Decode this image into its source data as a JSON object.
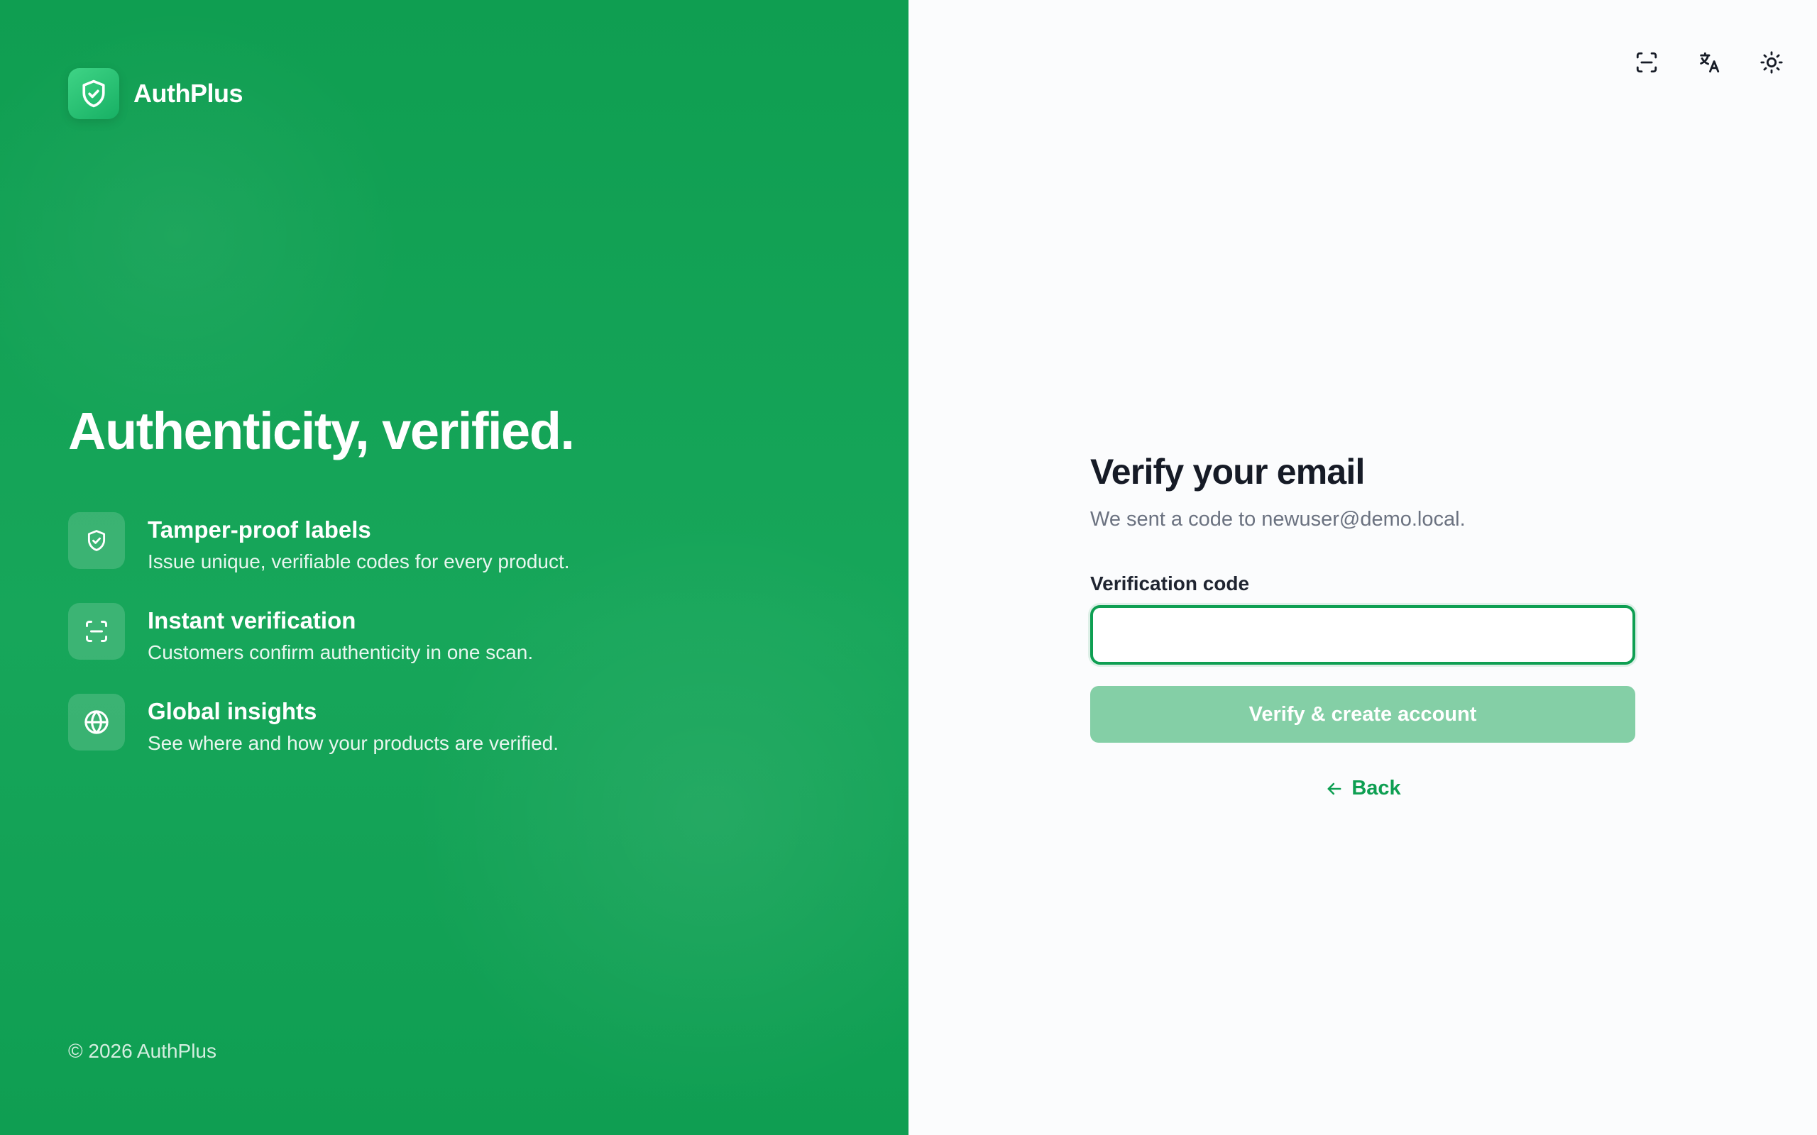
{
  "brand": {
    "name": "AuthPlus",
    "headline": "Authenticity, verified.",
    "features": [
      {
        "title": "Tamper-proof labels",
        "description": "Issue unique, verifiable codes for every product.",
        "icon": "shield-check-icon"
      },
      {
        "title": "Instant verification",
        "description": "Customers confirm authenticity in one scan.",
        "icon": "scan-icon"
      },
      {
        "title": "Global insights",
        "description": "See where and how your products are verified.",
        "icon": "globe-icon"
      }
    ],
    "copyright": "© 2026 AuthPlus",
    "colors": {
      "panel": "#12a052",
      "accent": "#0e9f52"
    }
  },
  "toolbar": {
    "items": [
      {
        "icon": "scan-icon",
        "label": "Scan"
      },
      {
        "icon": "translate-icon",
        "label": "Language"
      },
      {
        "icon": "sun-icon",
        "label": "Theme"
      }
    ]
  },
  "form": {
    "title": "Verify your email",
    "subtitle": "We sent a code to newuser@demo.local.",
    "code_label": "Verification code",
    "code_value": "",
    "code_placeholder": "",
    "submit_label": "Verify & create account",
    "back_label": "Back",
    "colors": {
      "submit_disabled": "#84cfa6",
      "title": "#161b26",
      "subtitle": "#6b7280"
    }
  }
}
